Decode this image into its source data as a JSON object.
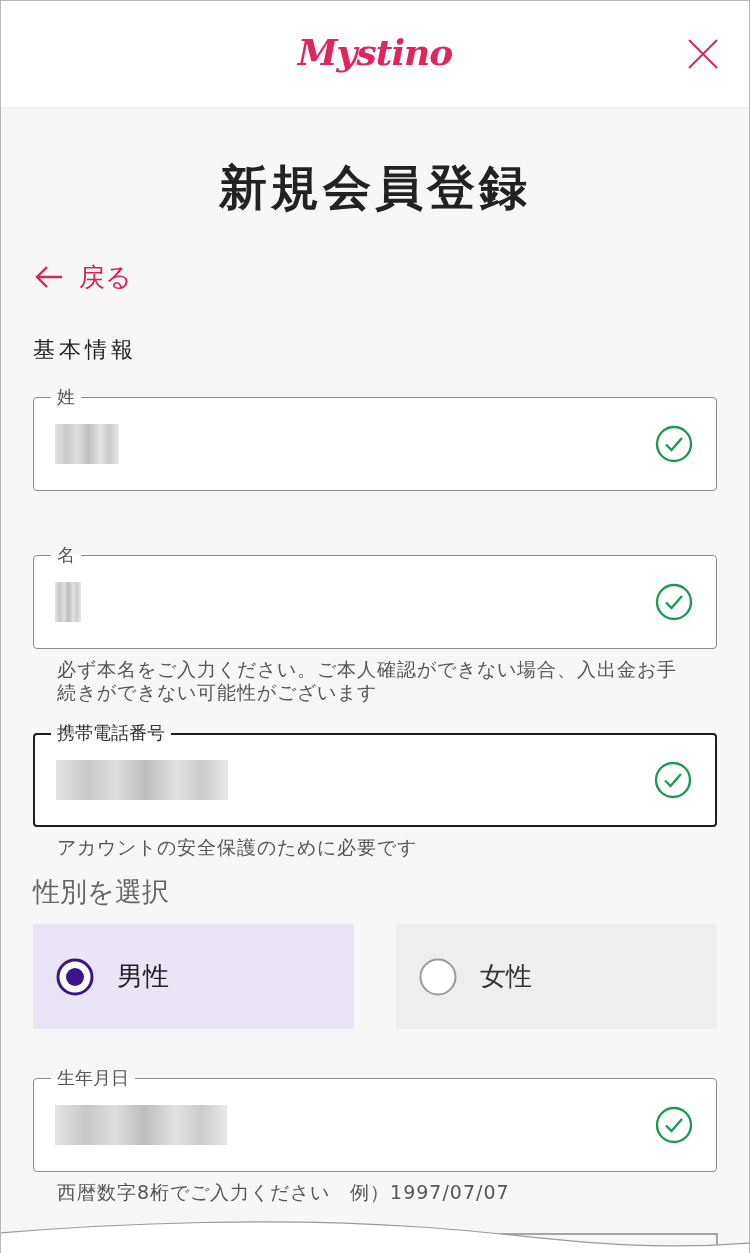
{
  "header": {
    "logo": "Mystino"
  },
  "title": "新規会員登録",
  "back_link": {
    "label": "戻る"
  },
  "section_title": "基本情報",
  "items": [
    {
      "kind": "field",
      "label": "姓",
      "value_blurred": true,
      "valid": true,
      "focused": false
    },
    {
      "kind": "field",
      "label": "名",
      "value_blurred": true,
      "valid": true,
      "focused": false,
      "helper": "必ず本名をご入力ください。ご本人確認ができない場合、入出金お手続きができない可能性がございます"
    },
    {
      "kind": "field",
      "label": "携帯電話番号",
      "value_blurred": true,
      "valid": true,
      "focused": true,
      "helper": "アカウントの安全保護のために必要です"
    },
    {
      "kind": "choice",
      "label": "性別を選択",
      "options": [
        {
          "label": "男性",
          "selected": true
        },
        {
          "label": "女性",
          "selected": false
        }
      ]
    },
    {
      "kind": "field",
      "label": "生年月日",
      "value_blurred": true,
      "valid": true,
      "focused": false,
      "helper": "西暦数字8桁でご入力ください　例）1997/07/07"
    }
  ]
}
